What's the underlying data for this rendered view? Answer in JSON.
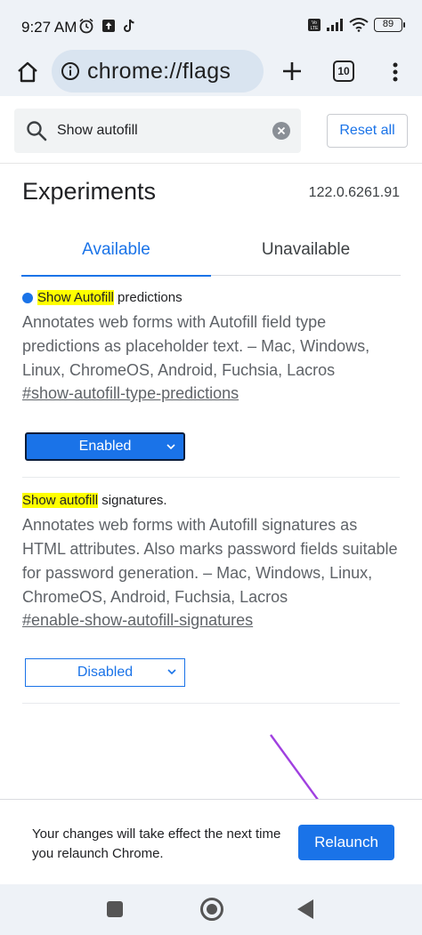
{
  "status_bar": {
    "time": "9:27 AM",
    "battery": "89",
    "icons_left": [
      "alarm-icon",
      "upload-icon",
      "tiktok-icon"
    ],
    "icons_right": [
      "volte-icon",
      "signal-icon",
      "wifi-icon",
      "battery-icon"
    ]
  },
  "toolbar": {
    "url": "chrome://flags",
    "tab_count": "10"
  },
  "search": {
    "query": "Show autofill",
    "reset_label": "Reset all"
  },
  "page": {
    "heading": "Experiments",
    "version": "122.0.6261.91",
    "tabs": [
      {
        "label": "Available"
      },
      {
        "label": "Unavailable"
      }
    ]
  },
  "experiments": [
    {
      "title_highlight": "Show Autofill",
      "title_rest": " predictions",
      "modified": true,
      "description": "Annotates web forms with Autofill field type predictions as placeholder text. – Mac, Windows, Linux, ChromeOS, Android, Fuchsia, Lacros",
      "link": "#show-autofill-type-predictions",
      "value": "Enabled"
    },
    {
      "title_highlight": "Show autofill",
      "title_rest": " signatures.",
      "modified": false,
      "description": "Annotates web forms with Autofill signatures as HTML attributes. Also marks password fields suitable for password generation. – Mac, Windows, Linux, ChromeOS, Android, Fuchsia, Lacros",
      "link": "#enable-show-autofill-signatures",
      "value": "Disabled"
    }
  ],
  "relaunch": {
    "message": "Your changes will take effect the next time you relaunch Chrome.",
    "button_label": "Relaunch"
  },
  "colors": {
    "accent": "#1a73e8",
    "highlight": "#ffff00",
    "annotation_arrow": "#a040e0"
  }
}
